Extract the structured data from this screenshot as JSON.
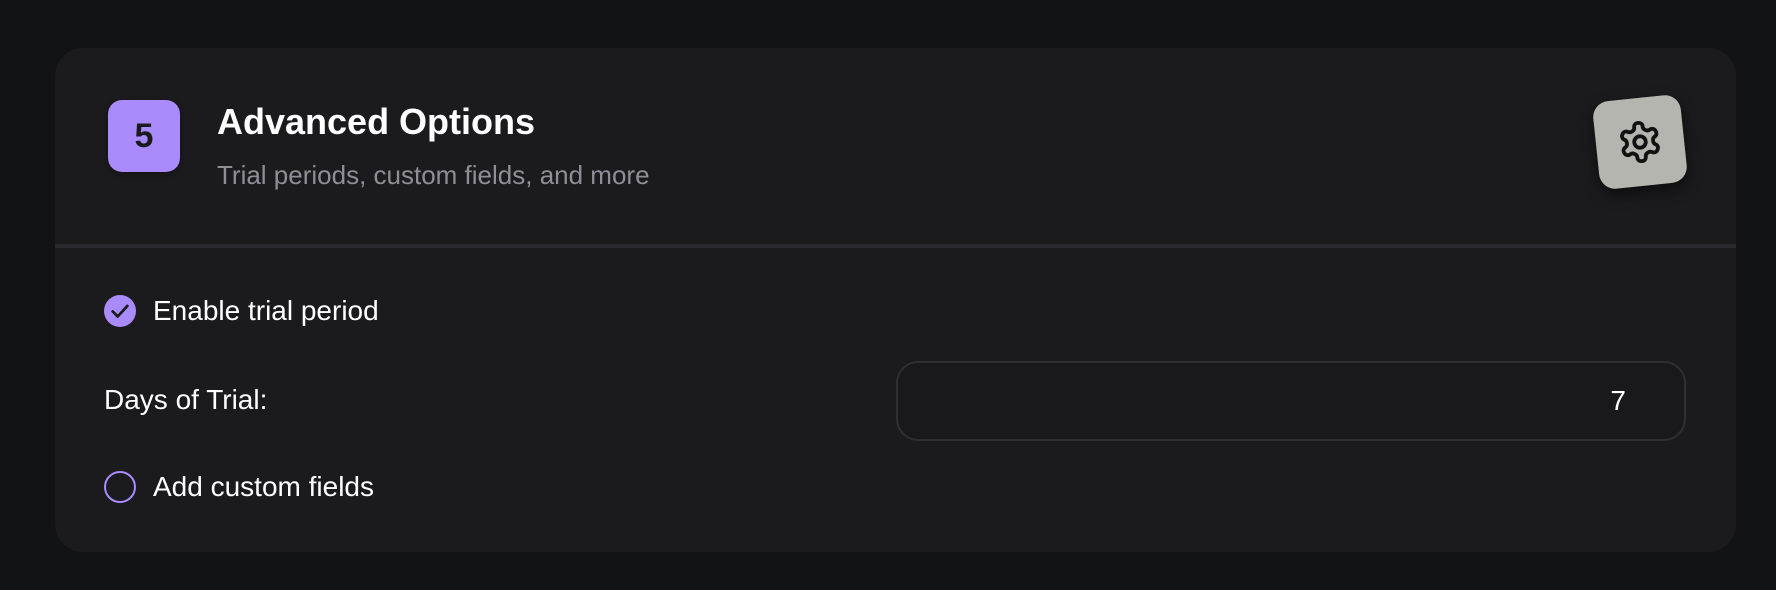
{
  "step": {
    "number": "5",
    "title": "Advanced Options",
    "subtitle": "Trial periods, custom fields, and more"
  },
  "settings_button": {
    "icon": "gear-icon"
  },
  "options": {
    "trial": {
      "label": "Enable trial period",
      "checked": true
    },
    "days_of_trial": {
      "label": "Days of Trial:",
      "value": "7"
    },
    "custom_fields": {
      "label": "Add custom fields",
      "checked": false
    }
  },
  "colors": {
    "accent": "#a98bfc",
    "background": "#121314",
    "card": "#1b1b1e",
    "muted_text": "#8e8e96",
    "gear_button": "#b5b5b0"
  }
}
